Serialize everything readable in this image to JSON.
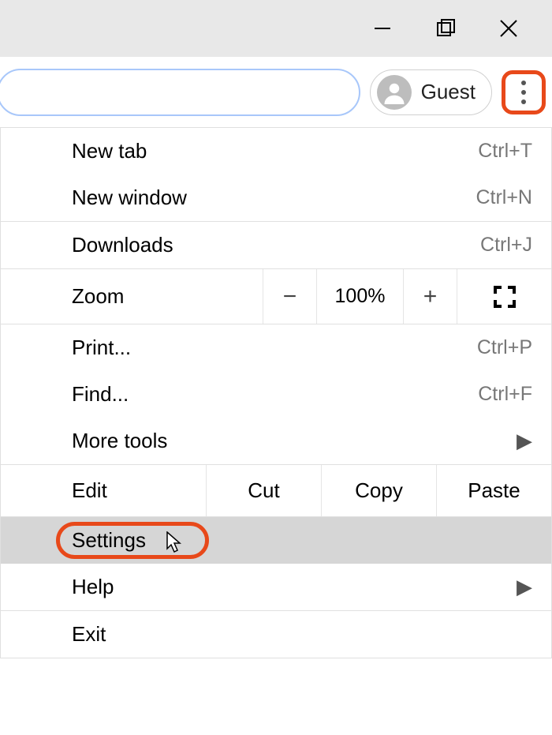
{
  "window": {
    "profile_label": "Guest"
  },
  "menu": {
    "new_tab": {
      "label": "New tab",
      "shortcut": "Ctrl+T"
    },
    "new_window": {
      "label": "New window",
      "shortcut": "Ctrl+N"
    },
    "downloads": {
      "label": "Downloads",
      "shortcut": "Ctrl+J"
    },
    "zoom": {
      "label": "Zoom",
      "minus": "−",
      "value": "100%",
      "plus": "+"
    },
    "print": {
      "label": "Print...",
      "shortcut": "Ctrl+P"
    },
    "find": {
      "label": "Find...",
      "shortcut": "Ctrl+F"
    },
    "more_tools": {
      "label": "More tools"
    },
    "edit": {
      "label": "Edit",
      "cut": "Cut",
      "copy": "Copy",
      "paste": "Paste"
    },
    "settings": {
      "label": "Settings"
    },
    "help": {
      "label": "Help"
    },
    "exit": {
      "label": "Exit"
    }
  }
}
